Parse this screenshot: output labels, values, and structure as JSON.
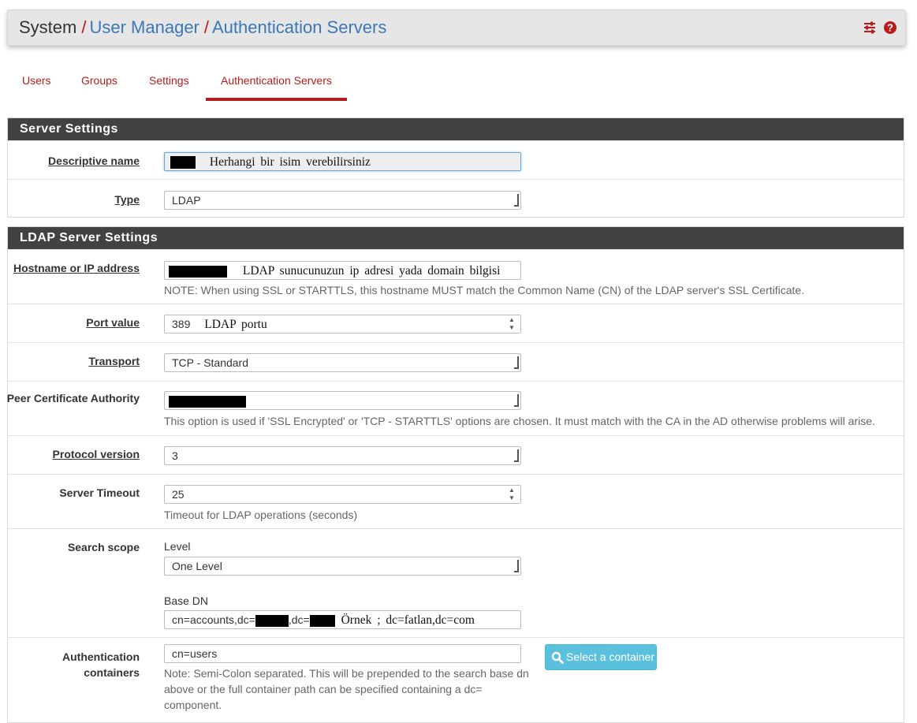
{
  "breadcrumb": {
    "root": "System",
    "sep": "/",
    "item1": "User Manager",
    "item2": "Authentication Servers"
  },
  "header_icons": [
    "sliders-icon",
    "help-circle-icon"
  ],
  "tabs": [
    "Users",
    "Groups",
    "Settings",
    "Authentication Servers"
  ],
  "active_tab": "Authentication Servers",
  "server_settings": {
    "title": "Server Settings",
    "descriptive_name": {
      "label": "Descriptive name",
      "annotation": "Herhangi bir isim verebilirsiniz"
    },
    "type": {
      "label": "Type",
      "value": "LDAP"
    }
  },
  "ldap_settings": {
    "title": "LDAP Server Settings",
    "hostname": {
      "label": "Hostname or IP address",
      "annotation": "LDAP sunucunuzun ip adresi yada domain bilgisi",
      "note": "NOTE: When using SSL or STARTTLS, this hostname MUST match the Common Name (CN) of the LDAP server's SSL Certificate."
    },
    "port": {
      "label": "Port value",
      "value": "389",
      "annotation": "LDAP portu"
    },
    "transport": {
      "label": "Transport",
      "value": "TCP - Standard"
    },
    "peer_ca": {
      "label": "Peer Certificate Authority",
      "note": "This option is used if 'SSL Encrypted' or 'TCP - STARTTLS' options are chosen. It must match with the CA in the AD otherwise problems will arise."
    },
    "protocol": {
      "label": "Protocol version",
      "value": "3"
    },
    "timeout": {
      "label": "Server Timeout",
      "value": "25",
      "note": "Timeout for LDAP operations (seconds)"
    },
    "search_scope": {
      "label": "Search scope",
      "level_label": "Level",
      "level_value": "One Level",
      "basedn_label": "Base DN",
      "basedn_prefix": "cn=accounts,dc=",
      "basedn_mid": ",dc=",
      "annotation": "Örnek ; dc=fatlan,dc=com"
    },
    "auth_containers": {
      "label1": "Authentication",
      "label2": "containers",
      "value": "cn=users",
      "button": "Select a container",
      "note1": "Note: Semi-Colon separated. This will be prepended to the search base dn",
      "note2": "above or the full container path can be specified containing a dc=",
      "note3": "component."
    }
  },
  "colors": {
    "accent": "#b71c1c",
    "link": "#3c78b5",
    "panel_header": "#424242",
    "button": "#5bc0de"
  }
}
